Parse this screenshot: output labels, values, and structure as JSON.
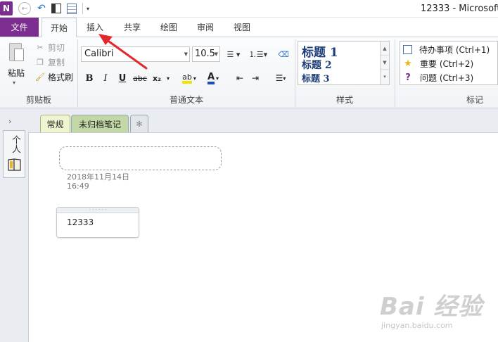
{
  "titlebar": {
    "app_icon": "N",
    "window_title": "12333 - Microsoft",
    "qat": {
      "back_icon": "back-circle-icon",
      "undo_icon": "undo-icon",
      "dock_icon": "dock-to-desktop-icon",
      "full_page_icon": "full-page-view-icon",
      "more": "▾"
    }
  },
  "ribbon_tabs": {
    "file": "文件",
    "home": "开始",
    "insert": "插入",
    "share": "共享",
    "draw": "绘图",
    "review": "审阅",
    "view": "视图"
  },
  "clipboard": {
    "paste": "粘贴",
    "cut": "剪切",
    "copy": "复制",
    "format_painter": "格式刷",
    "label": "剪贴板"
  },
  "basic_text": {
    "font_name": "Calibri",
    "font_size": "10.5",
    "bold": "B",
    "italic": "I",
    "underline": "U",
    "strikethrough": "abc",
    "subscript": "x₂",
    "label": "普通文本",
    "highlight_color": "#f5e400",
    "font_color": "#1a4fb5"
  },
  "styles": {
    "heading1": "标题 1",
    "heading2": "标题 2",
    "heading3": "标题 3",
    "label": "样式"
  },
  "tags": {
    "todo": "待办事项 (Ctrl+1)",
    "important": "重要 (Ctrl+2)",
    "question": "问题 (Ctrl+3)",
    "label": "标记"
  },
  "sections": {
    "nav_chevron": "›",
    "normal": "常规",
    "unfiled": "未归档笔记",
    "new_section_icon": "✻"
  },
  "notebook": {
    "name": "个人"
  },
  "page": {
    "date": "2018年11月14日",
    "time": "16:49",
    "note_text": "12333"
  },
  "watermark": {
    "main": "Bai 经验",
    "sub": "jingyan.baidu.com"
  },
  "colors": {
    "accent_purple": "#7b2e8f",
    "annotation_red": "#e0282e"
  }
}
